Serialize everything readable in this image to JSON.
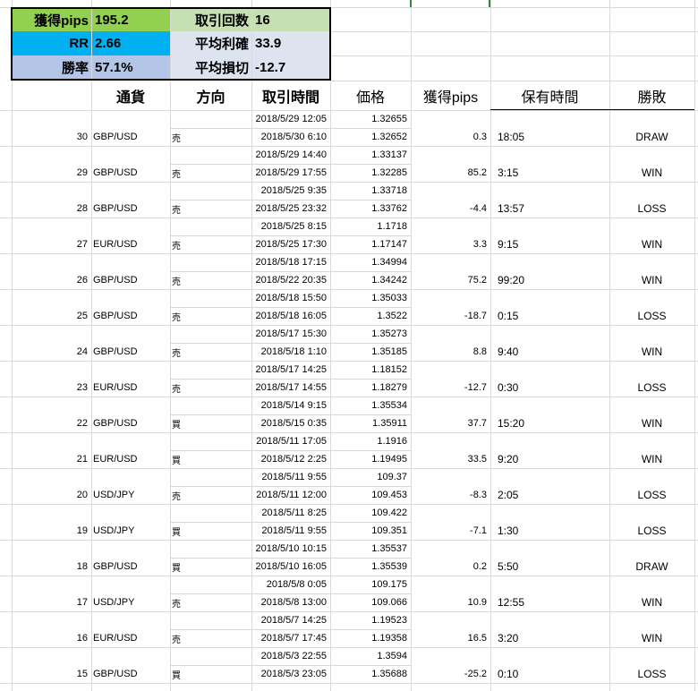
{
  "summary": {
    "pips_label": "獲得pips",
    "pips_value": "195.2",
    "rr_label": "RR",
    "rr_value": "2.66",
    "winrate_label": "勝率",
    "winrate_value": "57.1%",
    "trades_label": "取引回数",
    "trades_value": "16",
    "avg_profit_label": "平均利確",
    "avg_profit_value": "33.9",
    "avg_loss_label": "平均損切",
    "avg_loss_value": "-12.7"
  },
  "headers": {
    "currency": "通貨",
    "direction": "方向",
    "time": "取引時間",
    "price": "価格",
    "pips": "獲得pips",
    "hold": "保有時間",
    "result": "勝敗"
  },
  "colors": {
    "pips_bg": "#92d050",
    "rr_bg": "#00b0f0",
    "winrate_bg": "#b4c6e7",
    "trades_bg": "#c6e0b4",
    "grid": "#d9d9d9"
  },
  "trades": [
    {
      "no": "30",
      "pair": "GBP/USD",
      "dir": "売",
      "t1": "2018/5/29 12:05",
      "t2": "2018/5/30 6:10",
      "p1": "1.32655",
      "p2": "1.32652",
      "pips": "0.3",
      "hold": "18:05",
      "result": "DRAW"
    },
    {
      "no": "29",
      "pair": "GBP/USD",
      "dir": "売",
      "t1": "2018/5/29 14:40",
      "t2": "2018/5/29 17:55",
      "p1": "1.33137",
      "p2": "1.32285",
      "pips": "85.2",
      "hold": "3:15",
      "result": "WIN"
    },
    {
      "no": "28",
      "pair": "GBP/USD",
      "dir": "売",
      "t1": "2018/5/25 9:35",
      "t2": "2018/5/25 23:32",
      "p1": "1.33718",
      "p2": "1.33762",
      "pips": "-4.4",
      "hold": "13:57",
      "result": "LOSS"
    },
    {
      "no": "27",
      "pair": "EUR/USD",
      "dir": "売",
      "t1": "2018/5/25 8:15",
      "t2": "2018/5/25 17:30",
      "p1": "1.1718",
      "p2": "1.17147",
      "pips": "3.3",
      "hold": "9:15",
      "result": "WIN"
    },
    {
      "no": "26",
      "pair": "GBP/USD",
      "dir": "売",
      "t1": "2018/5/18 17:15",
      "t2": "2018/5/22 20:35",
      "p1": "1.34994",
      "p2": "1.34242",
      "pips": "75.2",
      "hold": "99:20",
      "result": "WIN"
    },
    {
      "no": "25",
      "pair": "GBP/USD",
      "dir": "売",
      "t1": "2018/5/18 15:50",
      "t2": "2018/5/18 16:05",
      "p1": "1.35033",
      "p2": "1.3522",
      "pips": "-18.7",
      "hold": "0:15",
      "result": "LOSS"
    },
    {
      "no": "24",
      "pair": "GBP/USD",
      "dir": "売",
      "t1": "2018/5/17 15:30",
      "t2": "2018/5/18 1:10",
      "p1": "1.35273",
      "p2": "1.35185",
      "pips": "8.8",
      "hold": "9:40",
      "result": "WIN"
    },
    {
      "no": "23",
      "pair": "EUR/USD",
      "dir": "売",
      "t1": "2018/5/17 14:25",
      "t2": "2018/5/17 14:55",
      "p1": "1.18152",
      "p2": "1.18279",
      "pips": "-12.7",
      "hold": "0:30",
      "result": "LOSS"
    },
    {
      "no": "22",
      "pair": "GBP/USD",
      "dir": "買",
      "t1": "2018/5/14 9:15",
      "t2": "2018/5/15 0:35",
      "p1": "1.35534",
      "p2": "1.35911",
      "pips": "37.7",
      "hold": "15:20",
      "result": "WIN"
    },
    {
      "no": "21",
      "pair": "EUR/USD",
      "dir": "買",
      "t1": "2018/5/11 17:05",
      "t2": "2018/5/12 2:25",
      "p1": "1.1916",
      "p2": "1.19495",
      "pips": "33.5",
      "hold": "9:20",
      "result": "WIN"
    },
    {
      "no": "20",
      "pair": "USD/JPY",
      "dir": "売",
      "t1": "2018/5/11 9:55",
      "t2": "2018/5/11 12:00",
      "p1": "109.37",
      "p2": "109.453",
      "pips": "-8.3",
      "hold": "2:05",
      "result": "LOSS"
    },
    {
      "no": "19",
      "pair": "USD/JPY",
      "dir": "買",
      "t1": "2018/5/11 8:25",
      "t2": "2018/5/11 9:55",
      "p1": "109.422",
      "p2": "109.351",
      "pips": "-7.1",
      "hold": "1:30",
      "result": "LOSS"
    },
    {
      "no": "18",
      "pair": "GBP/USD",
      "dir": "買",
      "t1": "2018/5/10 10:15",
      "t2": "2018/5/10 16:05",
      "p1": "1.35537",
      "p2": "1.35539",
      "pips": "0.2",
      "hold": "5:50",
      "result": "DRAW"
    },
    {
      "no": "17",
      "pair": "USD/JPY",
      "dir": "売",
      "t1": "2018/5/8 0:05",
      "t2": "2018/5/8 13:00",
      "p1": "109.175",
      "p2": "109.066",
      "pips": "10.9",
      "hold": "12:55",
      "result": "WIN"
    },
    {
      "no": "16",
      "pair": "EUR/USD",
      "dir": "売",
      "t1": "2018/5/7 14:25",
      "t2": "2018/5/7 17:45",
      "p1": "1.19523",
      "p2": "1.19358",
      "pips": "16.5",
      "hold": "3:20",
      "result": "WIN"
    },
    {
      "no": "15",
      "pair": "GBP/USD",
      "dir": "買",
      "t1": "2018/5/3 22:55",
      "t2": "2018/5/3 23:05",
      "p1": "1.3594",
      "p2": "1.35688",
      "pips": "-25.2",
      "hold": "0:10",
      "result": "LOSS"
    }
  ]
}
